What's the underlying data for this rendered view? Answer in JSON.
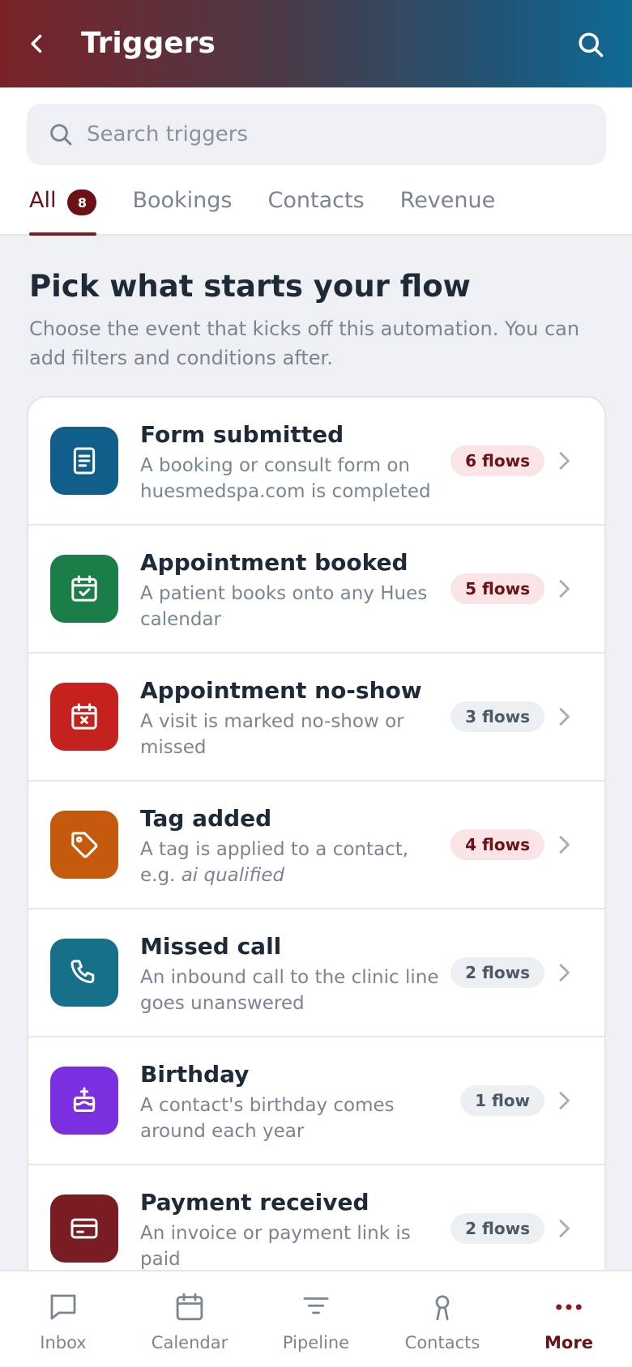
{
  "header": {
    "title": "Triggers"
  },
  "search": {
    "placeholder": "Search triggers"
  },
  "tabs": [
    {
      "label": "All",
      "badge": "8",
      "active": true
    },
    {
      "label": "Bookings",
      "active": false
    },
    {
      "label": "Contacts",
      "active": false
    },
    {
      "label": "Revenue",
      "active": false
    }
  ],
  "intro": {
    "title": "Pick what starts your flow",
    "subtitle": "Choose the event that kicks off this automation. You can add filters and conditions after."
  },
  "triggers": [
    {
      "title": "Form submitted",
      "desc": "A booking or consult form on huesmedspa.com is completed",
      "count": "6 flows",
      "tone": "hot",
      "icon": "form-icon",
      "color": "#0f5f8a"
    },
    {
      "title": "Appointment booked",
      "desc": "A patient books onto any Hues calendar",
      "count": "5 flows",
      "tone": "hot",
      "icon": "calendar-check-icon",
      "color": "#1b7d47"
    },
    {
      "title": "Appointment no-show",
      "desc": "A visit is marked no-show or missed",
      "count": "3 flows",
      "tone": "cool",
      "icon": "calendar-x-icon",
      "color": "#c4211f"
    },
    {
      "title": "Tag added",
      "desc_prefix": "A tag is applied to a contact, e.g.",
      "desc_em": "ai qualified",
      "count": "4 flows",
      "tone": "hot",
      "icon": "tag-icon",
      "color": "#c55a0e"
    },
    {
      "title": "Missed call",
      "desc": "An inbound call to the clinic line goes unanswered",
      "count": "2 flows",
      "tone": "cool",
      "icon": "phone-icon",
      "color": "#16708a"
    },
    {
      "title": "Birthday",
      "desc": "A contact's birthday comes around each year",
      "count": "1 flow",
      "tone": "cool",
      "icon": "cake-icon",
      "color": "#7c2fe0"
    },
    {
      "title": "Payment received",
      "desc": "An invoice or payment link is paid",
      "count": "2 flows",
      "tone": "cool",
      "icon": "credit-card-icon",
      "color": "#7a1d22"
    }
  ],
  "bottom_nav": [
    {
      "label": "Inbox",
      "icon": "inbox-icon",
      "active": false
    },
    {
      "label": "Calendar",
      "icon": "calendar-icon",
      "active": false
    },
    {
      "label": "Pipeline",
      "icon": "filter-icon",
      "active": false
    },
    {
      "label": "Contacts",
      "icon": "contact-icon",
      "active": false
    },
    {
      "label": "More",
      "icon": "more-icon",
      "active": true
    }
  ],
  "colors": {
    "accent": "#6b1217",
    "header_start": "#7a2227",
    "header_end": "#0f6a95"
  }
}
